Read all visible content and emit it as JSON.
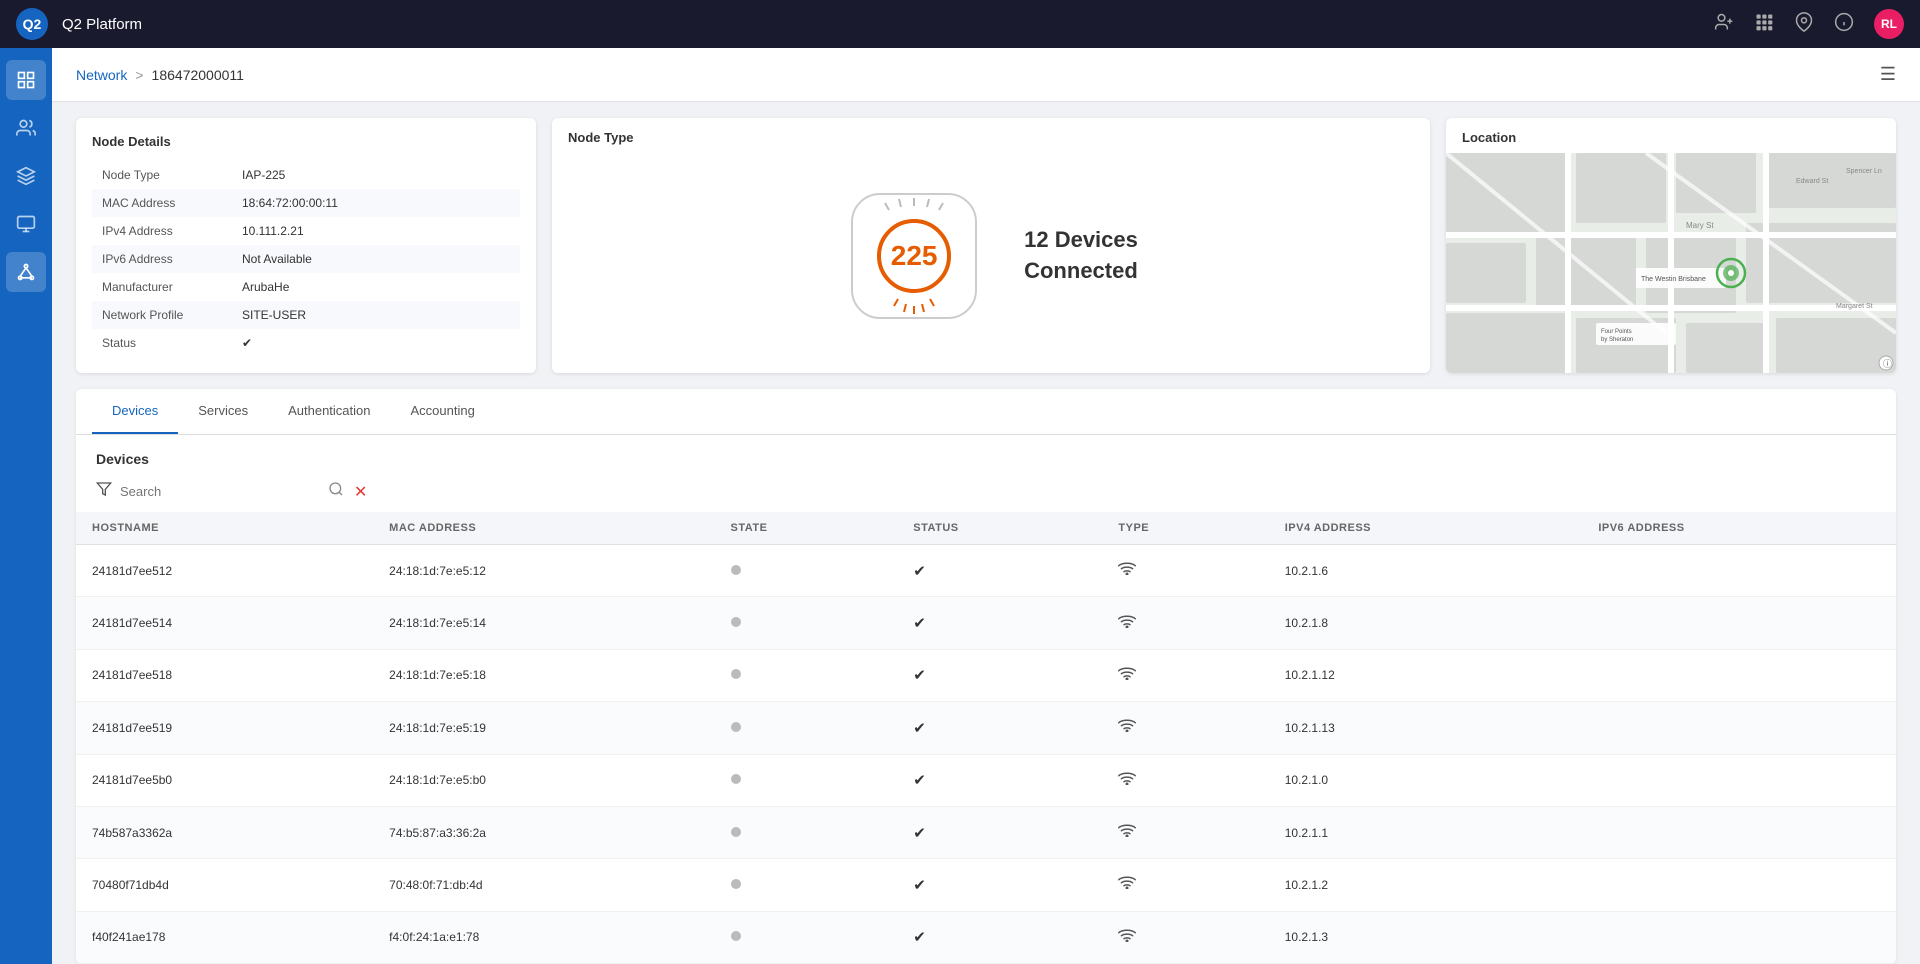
{
  "app": {
    "title": "Q2 Platform",
    "logo_initial": "Q2",
    "avatar_initials": "RL"
  },
  "breadcrumb": {
    "link_label": "Network",
    "separator": ">",
    "current": "186472000011"
  },
  "node_details": {
    "section_title": "Node Details",
    "rows": [
      {
        "label": "Node Type",
        "value": "IAP-225",
        "type": "link"
      },
      {
        "label": "MAC Address",
        "value": "18:64:72:00:00:11",
        "type": "normal"
      },
      {
        "label": "IPv4 Address",
        "value": "10.111.2.21",
        "type": "normal"
      },
      {
        "label": "IPv6 Address",
        "value": "Not Available",
        "type": "orange"
      },
      {
        "label": "Manufacturer",
        "value": "ArubaHe",
        "type": "normal"
      },
      {
        "label": "Network Profile",
        "value": "SITE-USER",
        "type": "normal"
      },
      {
        "label": "Status",
        "value": "✔",
        "type": "check"
      }
    ]
  },
  "node_type": {
    "section_title": "Node Type",
    "gauge_value": "225",
    "devices_line1": "12 Devices",
    "devices_line2": "Connected"
  },
  "location": {
    "section_title": "Location"
  },
  "tabs": [
    {
      "label": "Devices",
      "active": true
    },
    {
      "label": "Services",
      "active": false
    },
    {
      "label": "Authentication",
      "active": false
    },
    {
      "label": "Accounting",
      "active": false
    }
  ],
  "devices_section": {
    "title": "Devices",
    "search_placeholder": "Search"
  },
  "table": {
    "columns": [
      "HOSTNAME",
      "MAC ADDRESS",
      "STATE",
      "STATUS",
      "TYPE",
      "IPV4 ADDRESS",
      "IPV6 ADDRESS"
    ],
    "rows": [
      {
        "hostname": "24181d7ee512",
        "mac": "24:18:1d:7e:e5:12",
        "ipv4": "10.2.1.6",
        "ipv6": ""
      },
      {
        "hostname": "24181d7ee514",
        "mac": "24:18:1d:7e:e5:14",
        "ipv4": "10.2.1.8",
        "ipv6": ""
      },
      {
        "hostname": "24181d7ee518",
        "mac": "24:18:1d:7e:e5:18",
        "ipv4": "10.2.1.12",
        "ipv6": ""
      },
      {
        "hostname": "24181d7ee519",
        "mac": "24:18:1d:7e:e5:19",
        "ipv4": "10.2.1.13",
        "ipv6": ""
      },
      {
        "hostname": "24181d7ee5b0",
        "mac": "24:18:1d:7e:e5:b0",
        "ipv4": "10.2.1.0",
        "ipv6": ""
      },
      {
        "hostname": "74b587a3362a",
        "mac": "74:b5:87:a3:36:2a",
        "ipv4": "10.2.1.1",
        "ipv6": ""
      },
      {
        "hostname": "70480f71db4d",
        "mac": "70:48:0f:71:db:4d",
        "ipv4": "10.2.1.2",
        "ipv6": ""
      },
      {
        "hostname": "f40f241ae178",
        "mac": "f4:0f:24:1a:e1:78",
        "ipv4": "10.2.1.3",
        "ipv6": ""
      }
    ]
  }
}
